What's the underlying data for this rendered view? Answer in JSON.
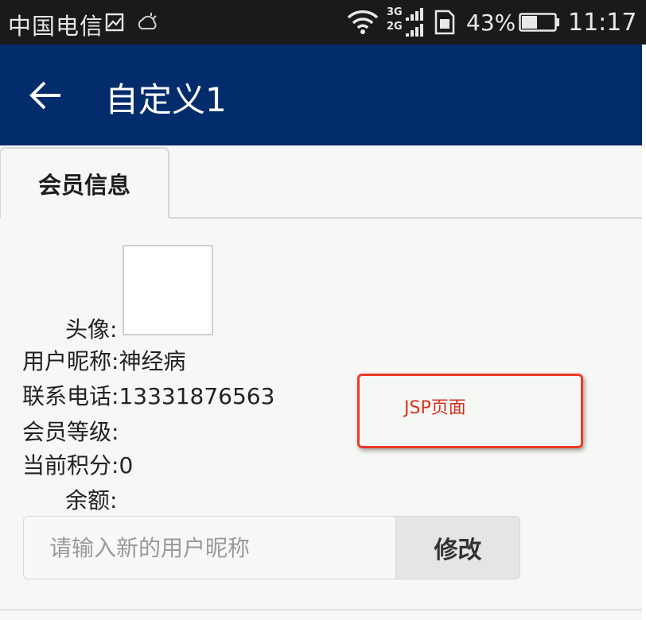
{
  "status_bar": {
    "carrier": "中国电信",
    "battery_percent": "43%",
    "time": "11:17",
    "network_top": "3G",
    "network_bottom": "2G",
    "icons": [
      "image-icon",
      "weather-icon",
      "wifi-icon",
      "signal-icon",
      "sim-icon",
      "battery-icon"
    ]
  },
  "app_bar": {
    "title": "自定义1",
    "back_icon": "arrow-left-icon",
    "color": "#022c6c"
  },
  "tabs": [
    {
      "label": "会员信息",
      "active": true
    }
  ],
  "member_info": {
    "avatar_label": "头像:",
    "nickname_label": "用户昵称:",
    "nickname_value": "神经病",
    "phone_label": "联系电话:",
    "phone_value": "13331876563",
    "level_label": "会员等级:",
    "level_value": "",
    "points_label": "当前积分:",
    "points_value": "0",
    "balance_label": "余额:",
    "balance_value": ""
  },
  "annotation": {
    "text": "JSP页面",
    "color": "#ee3a26"
  },
  "nickname_form": {
    "placeholder": "请输入新的用户昵称",
    "value": "",
    "button_label": "修改"
  }
}
